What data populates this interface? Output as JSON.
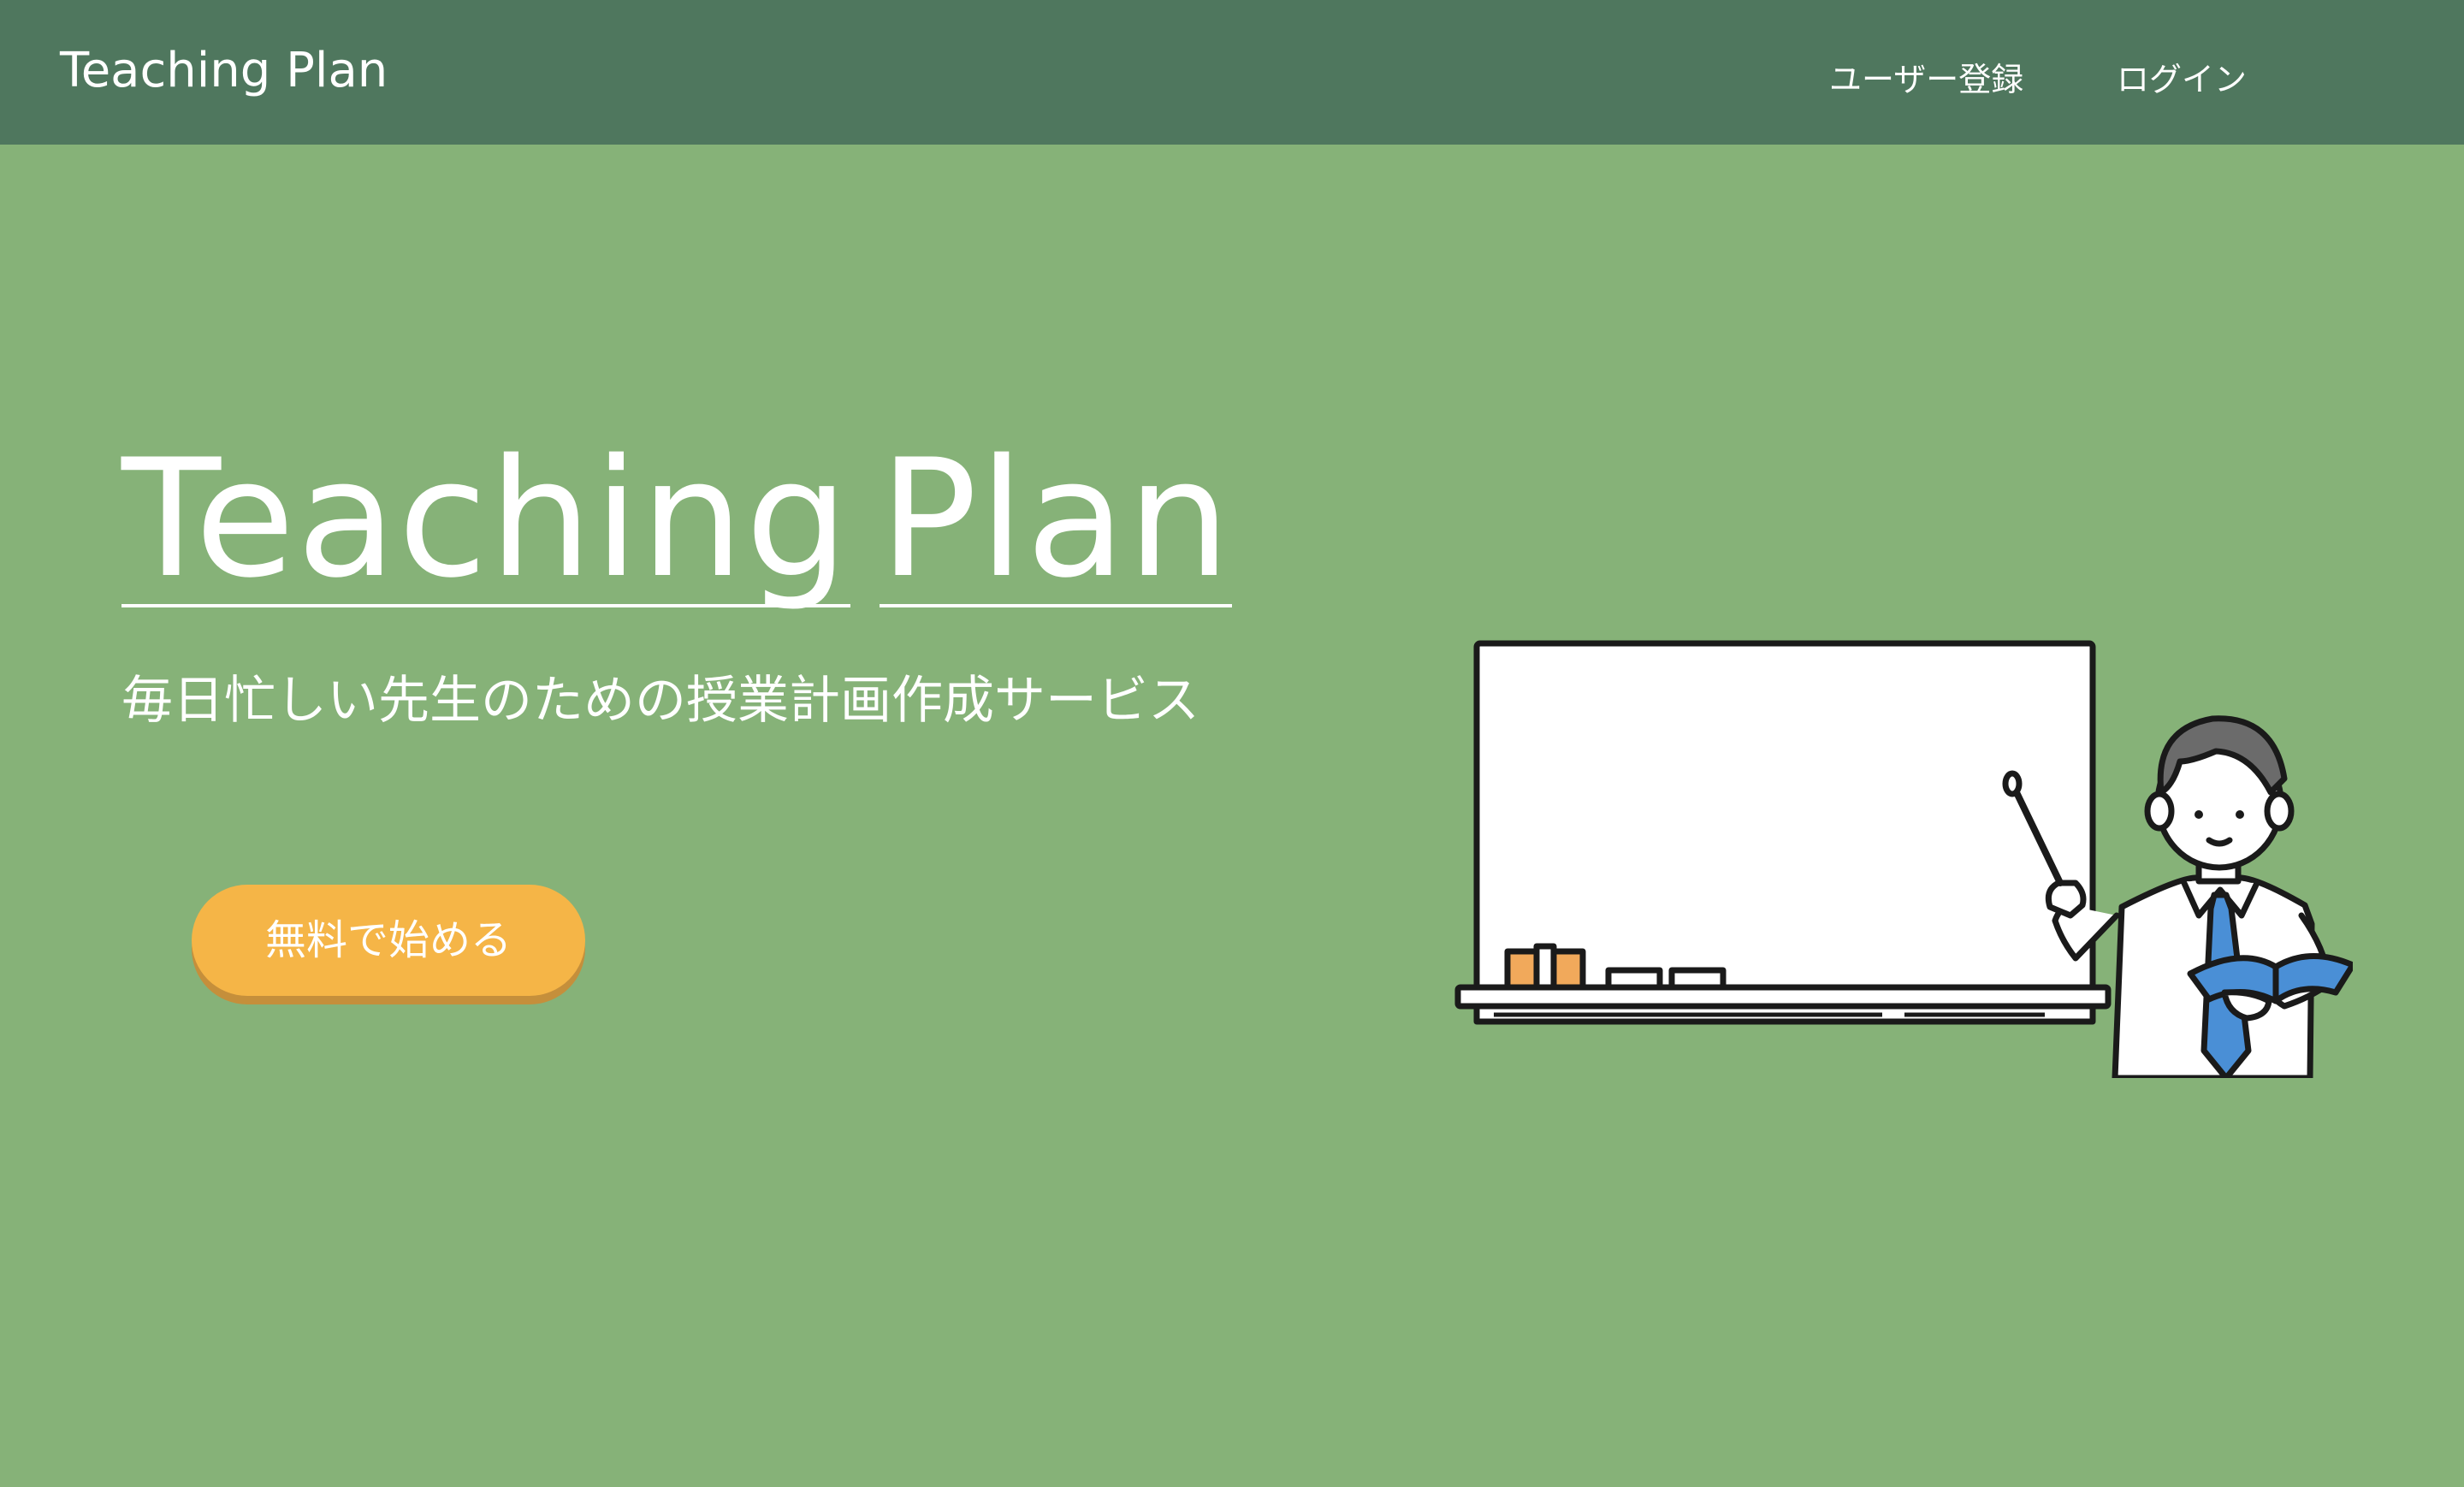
{
  "header": {
    "brand": "Teaching Plan",
    "nav": {
      "register": "ユーザー登録",
      "login": "ログイン"
    }
  },
  "hero": {
    "title_word1": "Teaching",
    "title_word2": "Plan",
    "subtitle": "毎日忙しい先生のための授業計画作成サービス",
    "cta_label": "無料で始める"
  },
  "colors": {
    "header_bg": "#4f775e",
    "page_bg": "#86b278",
    "cta_bg": "#f5b547",
    "tie": "#4a8fd6",
    "hair": "#6b6b6b"
  },
  "icons": {
    "illustration": "teacher-whiteboard-illustration"
  }
}
